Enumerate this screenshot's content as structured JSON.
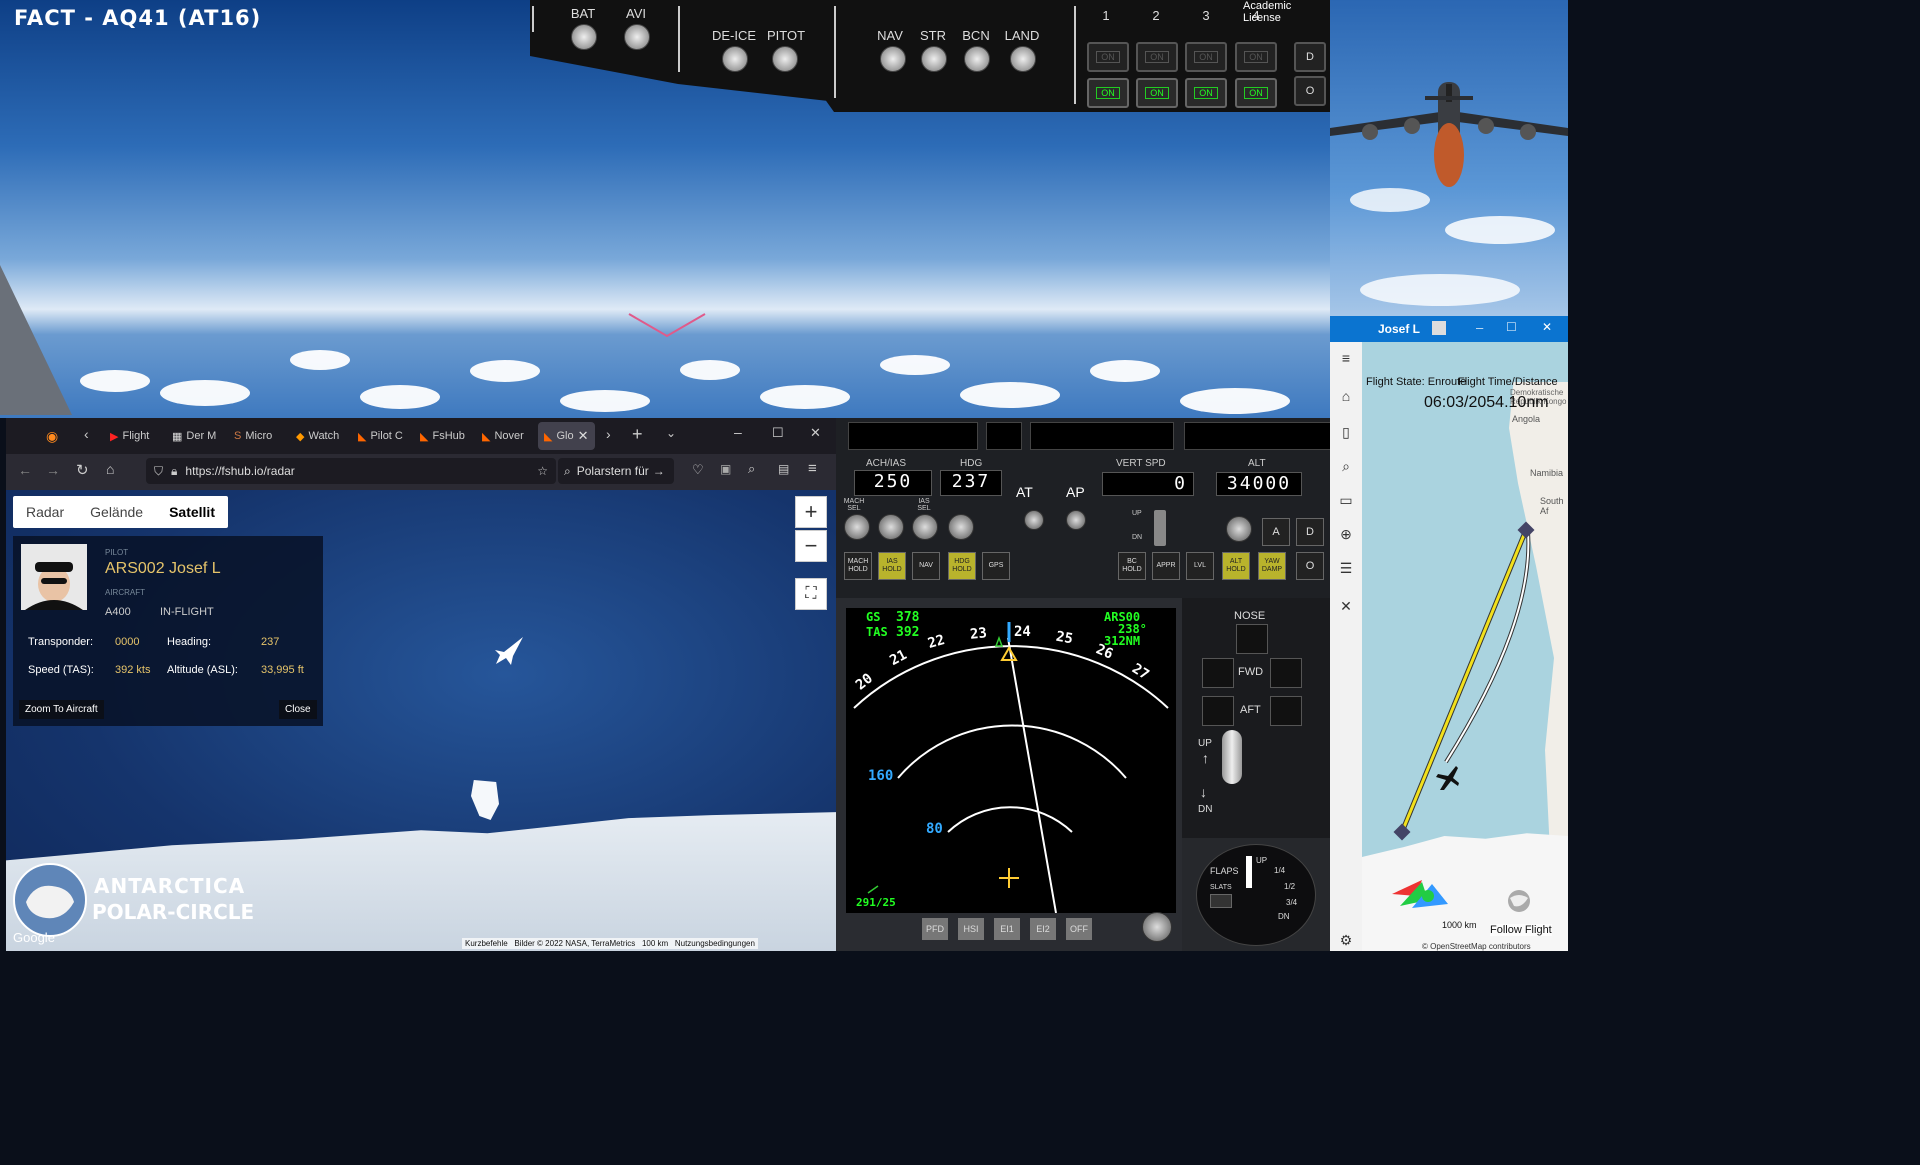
{
  "sim": {
    "title": "FACT - AQ41 (AT16)",
    "license": "Academic License"
  },
  "overhead": {
    "switches": [
      {
        "label": "BAT"
      },
      {
        "label": "AVI"
      },
      {
        "label": "DE-ICE"
      },
      {
        "label": "PITOT"
      },
      {
        "label": "NAV"
      },
      {
        "label": "STR"
      },
      {
        "label": "BCN"
      },
      {
        "label": "LAND"
      }
    ],
    "engines": [
      "1",
      "2",
      "3",
      "4"
    ],
    "engine_state_top": "ON",
    "engine_state_bottom": "ON",
    "side_buttons": [
      "D",
      "O"
    ]
  },
  "browser": {
    "tabs": [
      {
        "label": "Flight"
      },
      {
        "label": "Der M"
      },
      {
        "label": "Micro"
      },
      {
        "label": "Watch"
      },
      {
        "label": "Pilot C"
      },
      {
        "label": "FsHub"
      },
      {
        "label": "Nover"
      },
      {
        "label": "Glo"
      }
    ],
    "url": "https://fshub.io/radar",
    "search": "Polarstern für"
  },
  "radar": {
    "map_types": [
      "Radar",
      "Gelände",
      "Satellit"
    ],
    "selected_map_type": "Satellit",
    "pilot_label": "PILOT",
    "pilot_name": "ARS002 Josef L",
    "aircraft_label": "AIRCRAFT",
    "aircraft": "A400",
    "status": "IN-FLIGHT",
    "transponder_label": "Transponder:",
    "transponder": "0000",
    "heading_label": "Heading:",
    "heading": "237",
    "speed_label": "Speed (TAS):",
    "speed": "392 kts",
    "altitude_label": "Altitude (ASL):",
    "altitude": "33,995 ft",
    "zoom_to_aircraft": "Zoom To Aircraft",
    "close": "Close",
    "zoom_in": "+",
    "zoom_out": "−",
    "overlay_title_1": "ANTARCTICA",
    "overlay_title_2": "POLAR-CIRCLE",
    "google": "Google",
    "credits": [
      "Kurzbefehle",
      "Bilder © 2022 NASA, TerraMetrics",
      "100 km",
      "Nutzungsbedingungen"
    ]
  },
  "autopilot": {
    "labels": {
      "ias": "ACH/IAS",
      "hdg": "HDG",
      "vs": "VERT SPD",
      "alt": "ALT",
      "at": "AT",
      "ap": "AP"
    },
    "values": {
      "ias": "250",
      "hdg": "237",
      "vs": "0",
      "alt": "34000"
    },
    "buttons_left": [
      {
        "label": "MACH HOLD",
        "on": false
      },
      {
        "label": "IAS HOLD",
        "on": true
      },
      {
        "label": "NAV",
        "on": false
      },
      {
        "label": "HDG HOLD",
        "on": true
      },
      {
        "label": "GPS",
        "on": false
      }
    ],
    "buttons_right": [
      {
        "label": "BC HOLD",
        "on": false
      },
      {
        "label": "APPR",
        "on": false
      },
      {
        "label": "LVL",
        "on": false
      },
      {
        "label": "ALT HOLD",
        "on": true
      },
      {
        "label": "YAW DAMP",
        "on": true
      }
    ],
    "knob_labels": [
      "MACH SEL",
      "IAS SEL"
    ],
    "vs_up": "UP",
    "vs_dn": "DN",
    "side_buttons": [
      "A",
      "D",
      "O"
    ]
  },
  "nd": {
    "gs_label": "GS",
    "gs": "378",
    "tas_label": "TAS",
    "tas": "392",
    "waypoint": "ARS00",
    "wpt_bearing": "238°",
    "wpt_dist": "312NM",
    "compass": [
      "20",
      "21",
      "22",
      "23",
      "24",
      "25",
      "26",
      "27"
    ],
    "ranges": [
      "160",
      "80"
    ],
    "wind": "291/25",
    "softkeys": [
      "PFD",
      "HSI",
      "EI1",
      "EI2",
      "OFF"
    ]
  },
  "gear": {
    "nose": "NOSE",
    "fwd": "FWD",
    "aft": "AFT",
    "up": "UP",
    "dn": "DN"
  },
  "flaps": {
    "label": "FLAPS",
    "slats": "SLATS",
    "marks": [
      "UP",
      "1/4",
      "1/2",
      "3/4",
      "DN"
    ]
  },
  "fshub": {
    "user": "Josef L",
    "flight_state": "Flight State: Enroute",
    "time_distance_label": "Flight Time/Distance",
    "time_distance": "06:03/2054.10nm",
    "places": [
      "Angola",
      "Namibia",
      "South Af",
      "Demokratische Republik Kongo"
    ],
    "scale": "1000 km",
    "follow": "Follow Flight",
    "attribution": "© OpenStreetMap contributors"
  }
}
